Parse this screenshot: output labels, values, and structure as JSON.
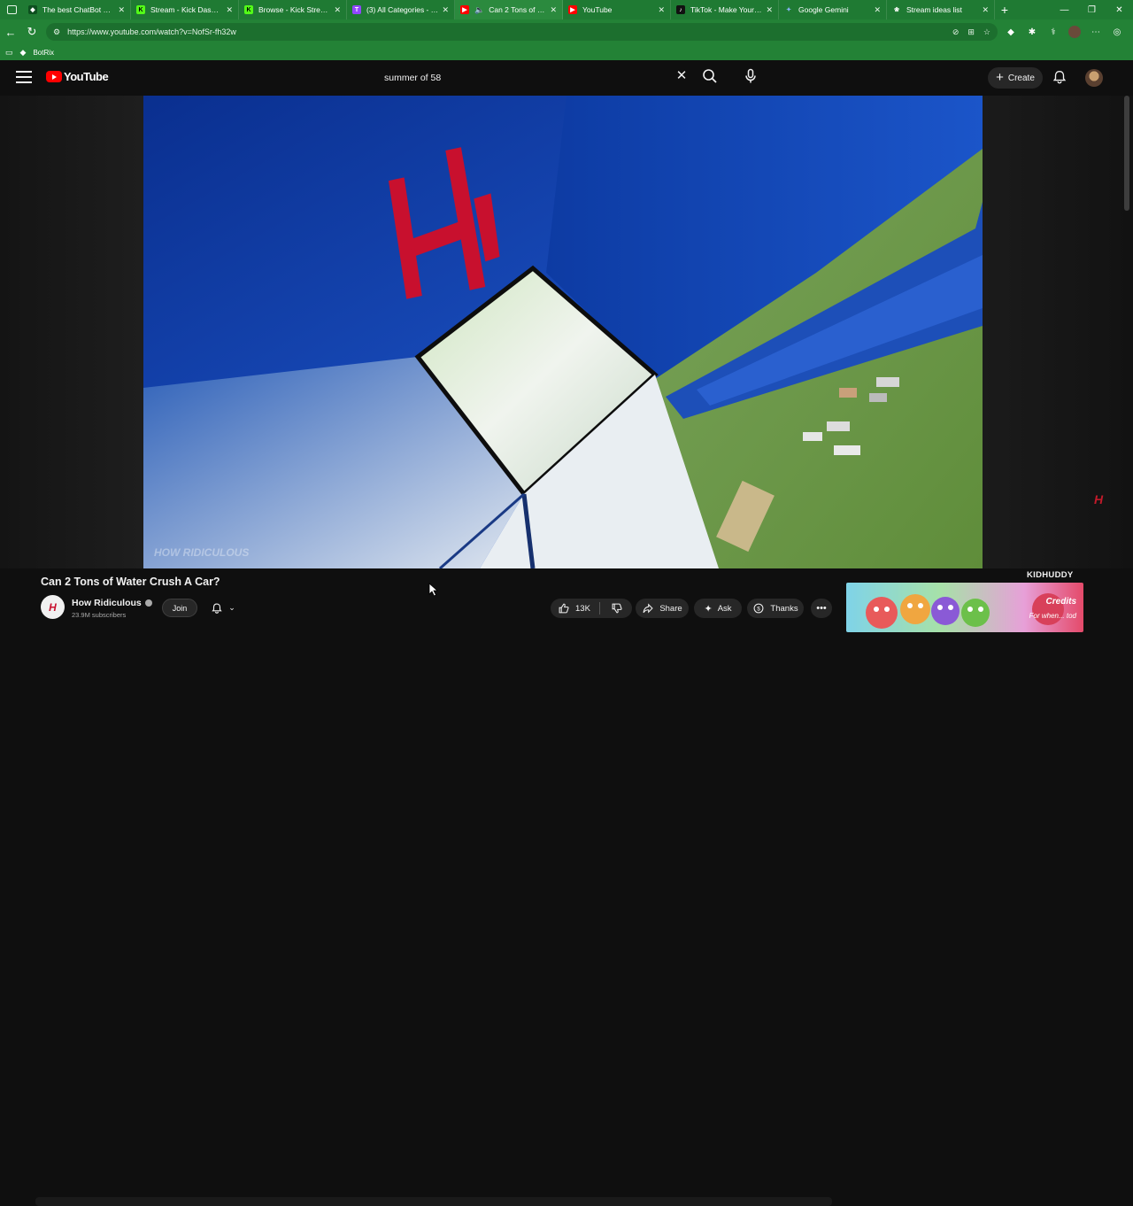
{
  "browser": {
    "tabs": [
      {
        "label": "The best ChatBot and",
        "favicon": "diamond-icon",
        "color": "#1f7a33"
      },
      {
        "label": "Stream - Kick Dashboa",
        "favicon": "kick-icon",
        "color": "#53fc18"
      },
      {
        "label": "Browse - Kick Streamin",
        "favicon": "kick-icon",
        "color": "#53fc18"
      },
      {
        "label": "(3) All Categories - Twi",
        "favicon": "twitch-icon",
        "color": "#9146ff"
      },
      {
        "label": "Can 2 Tons of Wat",
        "favicon": "youtube-icon",
        "color": "#ff0000"
      },
      {
        "label": "YouTube",
        "favicon": "youtube-icon",
        "color": "#ff0000"
      },
      {
        "label": "TikTok - Make Your Da",
        "favicon": "tiktok-icon",
        "color": "#000000"
      },
      {
        "label": "Google Gemini",
        "favicon": "gemini-icon",
        "color": "#4285f4"
      },
      {
        "label": "Stream ideas list",
        "favicon": "chatgpt-icon",
        "color": "#10a37f"
      }
    ],
    "new_tab_label": "+",
    "url": "https://www.youtube.com/watch?v=NofSr-fh32w",
    "bookmarks": [
      {
        "label": "BotRix"
      }
    ]
  },
  "youtube": {
    "logo_text": "YouTube",
    "search_value": "summer of 58",
    "create_label": "Create"
  },
  "video": {
    "title": "Can 2 Tons of Water Crush A Car?",
    "watermark": "HOW RIDICULOUS",
    "channel": {
      "name": "How Ridiculous",
      "subscribers": "23.9M subscribers",
      "avatar_letter": "H"
    },
    "join_label": "Join",
    "likes": "13K",
    "share_label": "Share",
    "ask_label": "Ask",
    "thanks_label": "Thanks"
  },
  "ad": {
    "brand": "KIDHUDDY",
    "headline": "Credits",
    "subline": "For when... tod"
  },
  "colors": {
    "browser_green": "#1f7a33",
    "yt_bg": "#0f0f0f",
    "yt_red": "#ff0000",
    "pill_bg": "#272727"
  }
}
